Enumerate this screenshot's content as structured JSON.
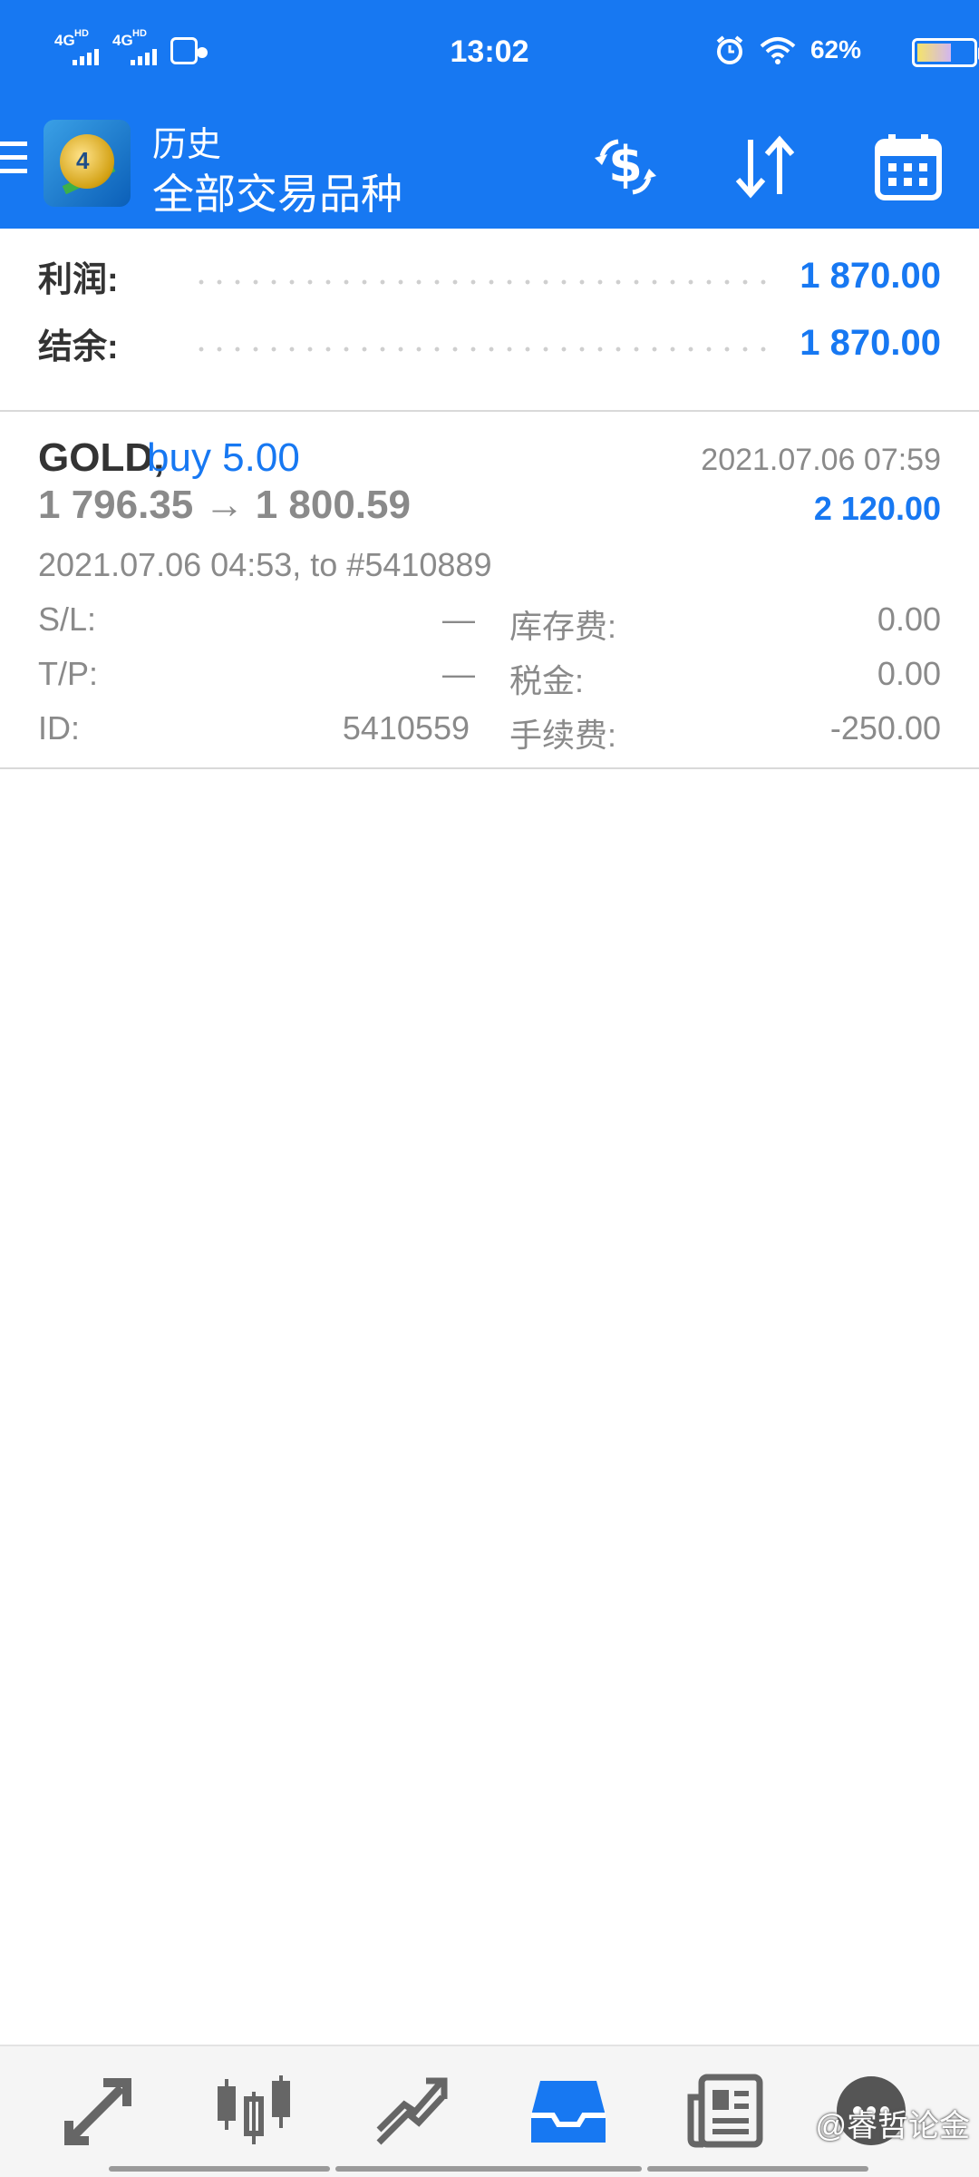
{
  "status": {
    "net1": "4G",
    "net1_sup": "HD",
    "net2": "4G",
    "net2_sup": "HD",
    "time": "13:02",
    "battery_text": "62%",
    "battery_level": 0.62
  },
  "appbar": {
    "title_small": "历史",
    "title_big": "全部交易品种"
  },
  "summary": {
    "profit_label": "利润:",
    "profit_value": "1 870.00",
    "balance_label": "结余:",
    "balance_value": "1 870.00"
  },
  "deal": {
    "symbol": "GOLD,",
    "direction": "buy 5.00",
    "close_time": "2021.07.06 07:59",
    "prices": "1 796.35 → 1 800.59",
    "profit": "2 120.00",
    "open_desc": "2021.07.06 04:53, to #5410889",
    "sl_label": "S/L:",
    "sl_value": "—",
    "tp_label": "T/P:",
    "tp_value": "—",
    "id_label": "ID:",
    "id_value": "5410559",
    "swap_label": "库存费:",
    "swap_value": "0.00",
    "tax_label": "税金:",
    "tax_value": "0.00",
    "fee_label": "手续费:",
    "fee_value": "-250.00"
  },
  "bottom_nav": {
    "items": [
      "quotes-icon",
      "chart-icon",
      "trade-icon",
      "history-icon",
      "news-icon",
      "chat-icon"
    ],
    "active": "history-icon"
  },
  "watermark": "@睿哲论金",
  "colors": {
    "brand_blue": "#1778f2",
    "text_dark": "#333333",
    "text_gray": "#8a8a8a"
  }
}
